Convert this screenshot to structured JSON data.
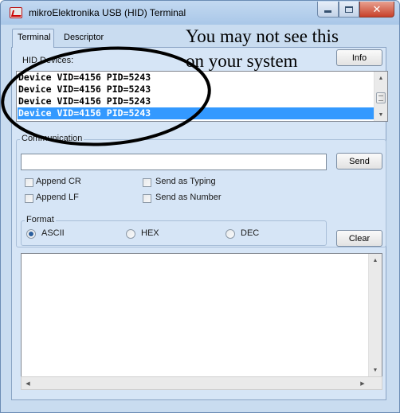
{
  "window": {
    "title": "mikroElektronika USB (HID) Terminal",
    "close_glyph": "✕",
    "accent_color": "#3399ff",
    "client_color": "#d6e5f6"
  },
  "tabs": [
    {
      "label": "Terminal",
      "active": true
    },
    {
      "label": "Descriptor",
      "active": false
    }
  ],
  "hid_devices": {
    "label": "HID Devices:",
    "items": [
      "Device VID=4156 PID=5243",
      "Device VID=4156 PID=5243",
      "Device VID=4156 PID=5243",
      "Device VID=4156 PID=5243"
    ],
    "selected_index": 3,
    "info_button": "Info"
  },
  "annotation": {
    "line1": "You may not see this",
    "line2": "on your system"
  },
  "communication": {
    "label": "Communication",
    "input_value": "",
    "send_button": "Send",
    "options": {
      "append_cr": "Append CR",
      "append_lf": "Append LF",
      "send_as_typing": "Send as Typing",
      "send_as_number": "Send as Number"
    }
  },
  "format": {
    "label": "Format",
    "options": [
      "ASCII",
      "HEX",
      "DEC"
    ],
    "selected": "ASCII",
    "clear_button": "Clear"
  },
  "icons": {
    "app": "app-logo-icon",
    "minimize": "minimize-icon",
    "maximize": "maximize-icon",
    "close": "close-icon",
    "scroll_up": "scroll-up-icon",
    "scroll_down": "scroll-down-icon",
    "scroll_left": "scroll-left-icon",
    "scroll_right": "scroll-right-icon"
  }
}
